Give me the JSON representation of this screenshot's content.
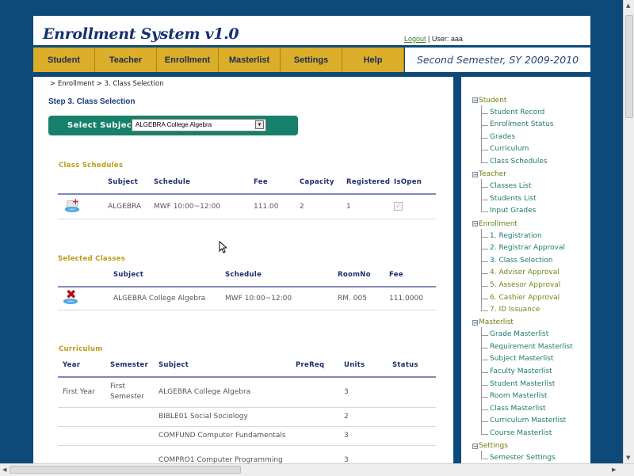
{
  "header": {
    "app_title": "Enrollment System v1.0",
    "logout_label": "Logout",
    "separator": "|",
    "user_label": "User: aaa"
  },
  "nav": {
    "items": [
      "Student",
      "Teacher",
      "Enrollment",
      "Masterlist",
      "Settings",
      "Help"
    ],
    "semester": "Second Semester, SY 2009-2010"
  },
  "main": {
    "breadcrumb": "> Enrollment > 3. Class Selection",
    "step_title": "Step 3. Class Selection",
    "select_subject_label": "Select Subject:",
    "select_subject_value": "ALGEBRA College Algebra",
    "class_schedules": {
      "title": "Class Schedules",
      "headers": [
        "",
        "Subject",
        "Schedule",
        "Fee",
        "Capacity",
        "Registered",
        "IsOpen"
      ],
      "rows": [
        {
          "icon": "add-class-icon",
          "subject": "ALGEBRA",
          "schedule": "MWF 10:00~12:00",
          "fee": "111.00",
          "capacity": "2",
          "registered": "1",
          "is_open": true
        }
      ]
    },
    "selected_classes": {
      "title": "Selected Classes",
      "headers": [
        "",
        "Subject",
        "Schedule",
        "RoomNo",
        "Fee"
      ],
      "rows": [
        {
          "icon": "remove-class-icon",
          "subject": "ALGEBRA College Algebra",
          "schedule": "MWF 10:00~12:00",
          "room": "RM. 005",
          "fee": "111.0000"
        }
      ]
    },
    "curriculum": {
      "title": "Curriculum",
      "headers": [
        "Year",
        "Semester",
        "Subject",
        "PreReq",
        "Units",
        "Status"
      ],
      "rows": [
        {
          "year": "First Year",
          "semester": "First Semester",
          "subject": "ALGEBRA College Algebra",
          "prereq": "",
          "units": "3",
          "status": ""
        },
        {
          "year": "",
          "semester": "",
          "subject": "BIBLE01 Social Sociology",
          "prereq": "",
          "units": "2",
          "status": ""
        },
        {
          "year": "",
          "semester": "",
          "subject": "COMFUND Computer Fundamentals",
          "prereq": "",
          "units": "3",
          "status": ""
        },
        {
          "year": "",
          "semester": "",
          "subject": "COMPRO1 Computer Programming",
          "prereq": "",
          "units": "3",
          "status": ""
        }
      ]
    }
  },
  "tree": {
    "groups": [
      {
        "label": "Student",
        "items": [
          "Student Record",
          "Enrollment Status",
          "Grades",
          "Curriculum",
          "Class Schedules"
        ]
      },
      {
        "label": "Teacher",
        "items": [
          "Classes List",
          "Students List",
          "Input Grades"
        ]
      },
      {
        "label": "Enrollment",
        "items": [
          "1. Registration",
          "2. Registrar Approval",
          "3. Class Selection",
          "4. Adviser Approval",
          "5. Assesor Approval",
          "6. Cashier Approval",
          "7. ID Issuance"
        ]
      },
      {
        "label": "Masterlist",
        "items": [
          "Grade Masterlist",
          "Requirement Masterlist",
          "Subject Masterlist",
          "Faculty Masterlist",
          "Student Masterlist",
          "Room Masterlist",
          "Class Masterlist",
          "Curriculum Masterlist",
          "Course Masterlist"
        ]
      },
      {
        "label": "Settings",
        "items": [
          "Semester Settings"
        ]
      }
    ]
  },
  "colors": {
    "background": "#0d4a79",
    "nav": "#dbae2a",
    "subject_bar": "#16806a",
    "section_title": "#b89d16",
    "header_text": "#1d2d6c"
  }
}
